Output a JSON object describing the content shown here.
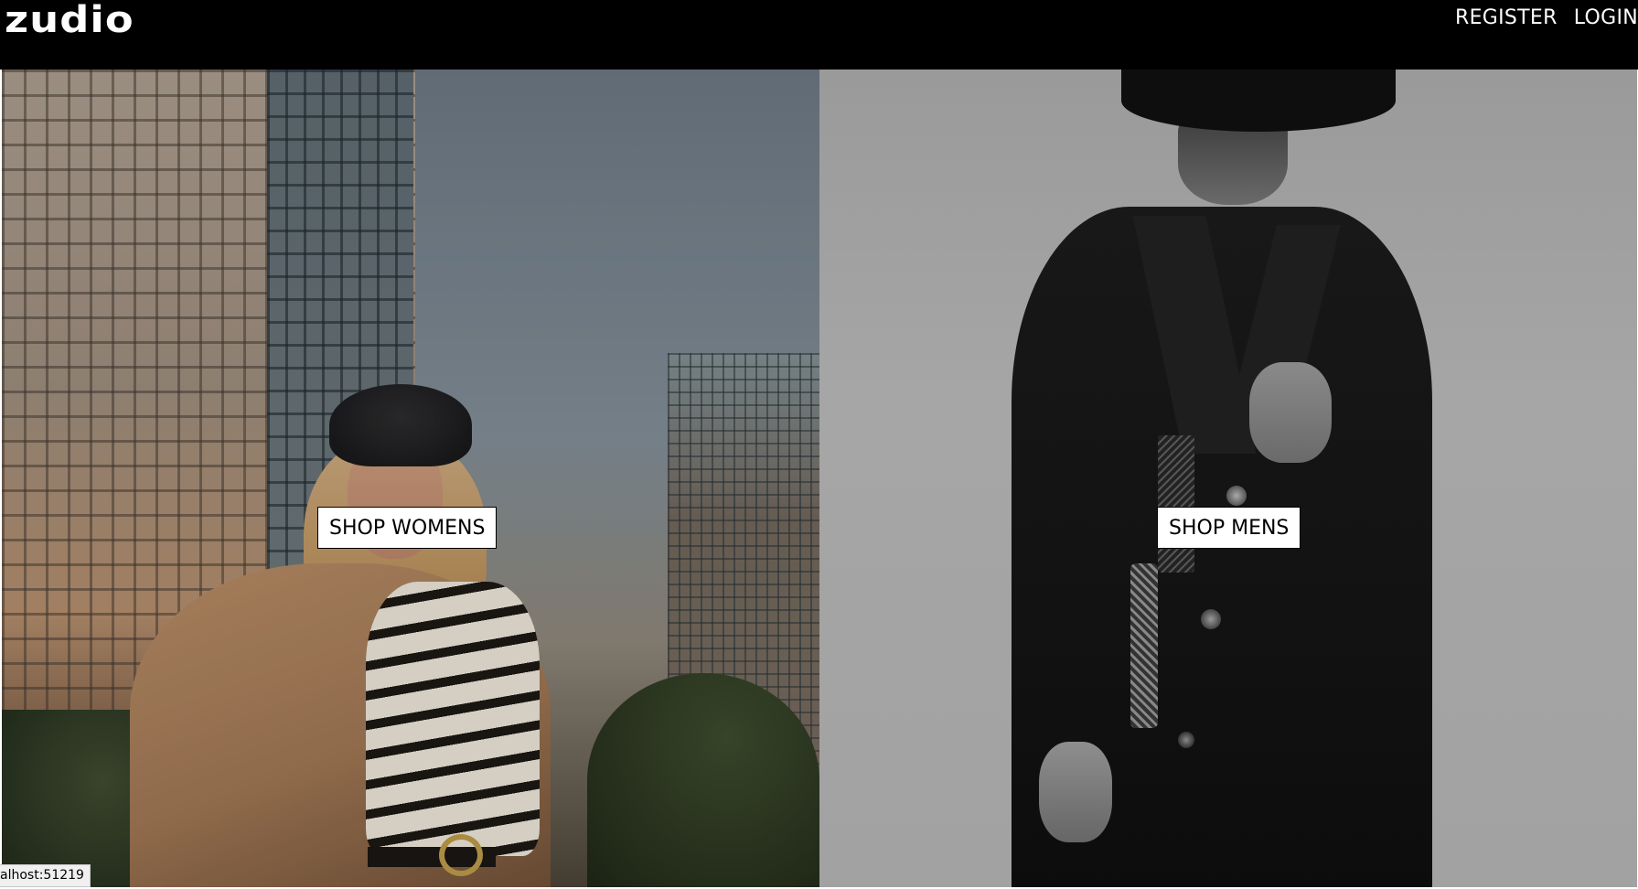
{
  "header": {
    "logo_text": "zudio",
    "nav": [
      {
        "label": "REGISTER"
      },
      {
        "label": "LOGIN"
      }
    ]
  },
  "panels": {
    "women": {
      "button_label": "SHOP WOMENS"
    },
    "men": {
      "button_label": "SHOP MENS"
    }
  },
  "status_bar": {
    "text": "alhost:51219"
  },
  "colors": {
    "navbar_bg": "#000000",
    "button_bg": "#ffffff",
    "button_text": "#000000"
  }
}
